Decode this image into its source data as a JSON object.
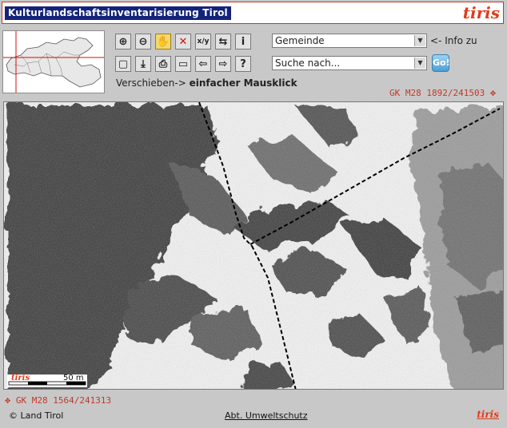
{
  "app": {
    "title": "Kulturlandschaftsinventarisierung Tirol",
    "brand": "tiris"
  },
  "toolbar": {
    "row1": [
      {
        "name": "zoom-in-icon",
        "glyph": "⊕"
      },
      {
        "name": "zoom-out-icon",
        "glyph": "⊖"
      },
      {
        "name": "pan-hand-icon",
        "glyph": "✋"
      },
      {
        "name": "delete-icon",
        "glyph": "✕"
      },
      {
        "name": "xy-coordinate-icon",
        "glyph": "x/y"
      },
      {
        "name": "measure-icon",
        "glyph": "⇆"
      },
      {
        "name": "info-icon",
        "glyph": "i"
      }
    ],
    "row2": [
      {
        "name": "full-extent-icon",
        "glyph": "▢"
      },
      {
        "name": "download-icon",
        "glyph": "⤓"
      },
      {
        "name": "print-icon",
        "glyph": "⎙"
      },
      {
        "name": "legend-icon",
        "glyph": "▭"
      },
      {
        "name": "back-arrow-icon",
        "glyph": "⇦"
      },
      {
        "name": "forward-arrow-icon",
        "glyph": "⇨"
      },
      {
        "name": "help-icon",
        "glyph": "?"
      }
    ]
  },
  "info_select": {
    "value": "Gemeinde",
    "label": "<- Info zu"
  },
  "search_select": {
    "value": "Suche nach...",
    "go_label": "Go!"
  },
  "hint": {
    "prefix": "Verschieben-> ",
    "action": "einfacher Mausklick"
  },
  "coords": {
    "top": "GK M28 1892/241503",
    "bottom": "GK M28 1564/241313"
  },
  "scalebar": {
    "brand": "tiris",
    "label": "50 m"
  },
  "footer": {
    "copyright": "© Land Tirol",
    "link": "Abt. Umweltschutz",
    "brand": "tiris"
  },
  "colors": {
    "title_bg": "#14237a",
    "brand": "#e03c1c",
    "coord": "#c0392b"
  }
}
